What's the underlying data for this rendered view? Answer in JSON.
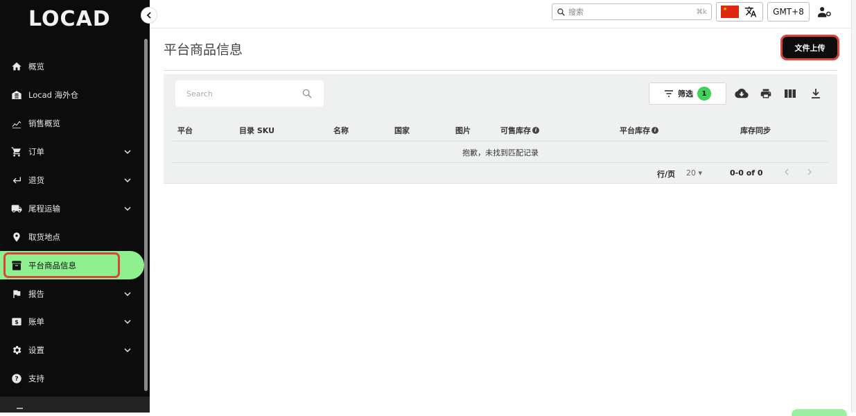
{
  "app": {
    "logo": "LOCAD"
  },
  "sidebar": {
    "items": [
      {
        "label": "概览",
        "icon": "home-icon",
        "has_children": false,
        "active": false
      },
      {
        "label": "Locad 海外仓",
        "icon": "warehouse-icon",
        "has_children": false,
        "active": false
      },
      {
        "label": "销售概览",
        "icon": "analytics-icon",
        "has_children": false,
        "active": false
      },
      {
        "label": "订单",
        "icon": "cart-icon",
        "has_children": true,
        "active": false
      },
      {
        "label": "退货",
        "icon": "return-icon",
        "has_children": true,
        "active": false
      },
      {
        "label": "尾程运输",
        "icon": "truck-icon",
        "has_children": true,
        "active": false
      },
      {
        "label": "取货地点",
        "icon": "location-pin-icon",
        "has_children": false,
        "active": false
      },
      {
        "label": "平台商品信息",
        "icon": "archive-icon",
        "has_children": false,
        "active": true
      },
      {
        "label": "报告",
        "icon": "flag-icon",
        "has_children": true,
        "active": false
      },
      {
        "label": "账单",
        "icon": "billing-icon",
        "has_children": true,
        "active": false
      },
      {
        "label": "设置",
        "icon": "gear-icon",
        "has_children": true,
        "active": false
      },
      {
        "label": "支持",
        "icon": "help-icon",
        "has_children": false,
        "active": false
      }
    ]
  },
  "topbar": {
    "search_placeholder": "搜索",
    "search_shortcut": "⌘k",
    "timezone": "GMT+8"
  },
  "page": {
    "title": "平台商品信息",
    "upload_label": "文件上传"
  },
  "table": {
    "search_placeholder": "Search",
    "filter_label": "筛选",
    "filter_count": "1",
    "columns": [
      "平台",
      "目录 SKU",
      "名称",
      "国家",
      "图片",
      "可售库存",
      "平台库存",
      "库存同步"
    ],
    "empty_message": "抱歉，未找到匹配记录",
    "rows_per_page_label": "行/页",
    "rows_per_page": "20",
    "range": "0-0 of 0"
  },
  "colors": {
    "sidebar_bg": "#0c0c0c",
    "active_item_bg": "#8ef08f",
    "highlight_outline": "#d9453a",
    "card_bg": "#eef1ef",
    "badge_green": "#3fd15a"
  }
}
